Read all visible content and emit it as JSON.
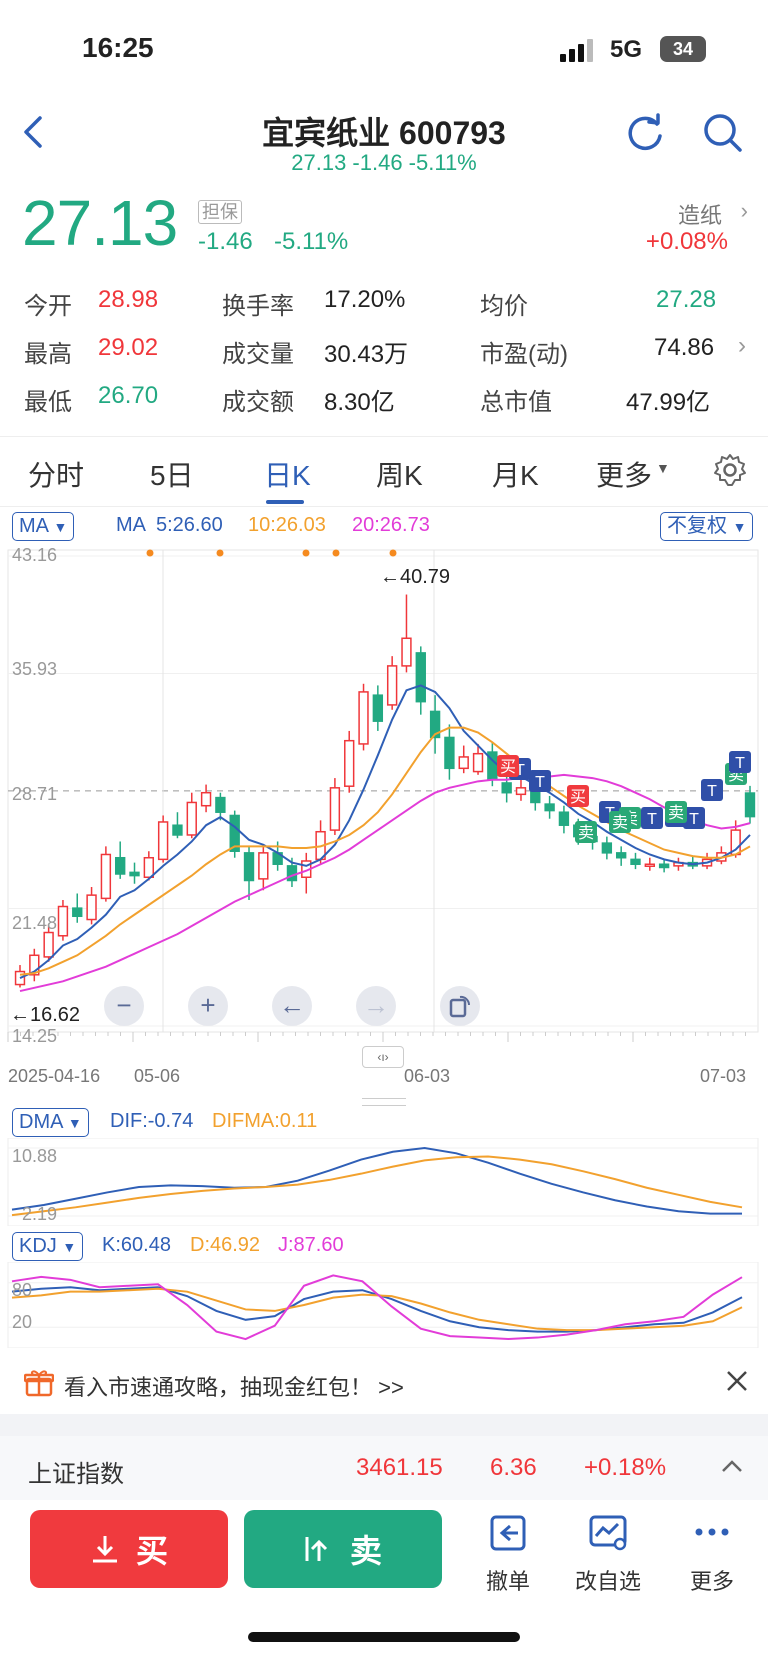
{
  "status": {
    "time": "16:25",
    "network": "5G",
    "battery": "34"
  },
  "header": {
    "stock_name_code": "宜宾纸业 600793",
    "subtitle": "27.13 -1.46 -5.11%"
  },
  "quote": {
    "price": "27.13",
    "badge": "担保",
    "change": "-1.46",
    "change_pct": "-5.11%",
    "sector": "造纸",
    "sector_change": "+0.08%"
  },
  "stats": [
    [
      {
        "label": "今开",
        "value": "28.98",
        "color": "red"
      },
      {
        "label": "换手率",
        "value": "17.20%",
        "color": "dark"
      },
      {
        "label": "均价",
        "value": "27.28",
        "color": "green"
      }
    ],
    [
      {
        "label": "最高",
        "value": "29.02",
        "color": "red"
      },
      {
        "label": "成交量",
        "value": "30.43万",
        "color": "dark"
      },
      {
        "label": "市盈(动)",
        "value": "74.86",
        "color": "dark"
      }
    ],
    [
      {
        "label": "最低",
        "value": "26.70",
        "color": "green"
      },
      {
        "label": "成交额",
        "value": "8.30亿",
        "color": "dark"
      },
      {
        "label": "总市值",
        "value": "47.99亿",
        "color": "dark"
      }
    ]
  ],
  "tabs": [
    "分时",
    "5日",
    "日K",
    "周K",
    "月K",
    "更多"
  ],
  "active_tab": "日K",
  "chart_top": {
    "ma_chip": "MA",
    "ma_label": "MA",
    "ma5": "5:26.60",
    "ma10": "10:26.03",
    "ma20": "20:26.73",
    "adjust_chip": "不复权",
    "y_labels": [
      "43.16",
      "35.93",
      "28.71",
      "21.48",
      "14.25"
    ],
    "high_marker": "←40.79",
    "low_marker": "←16.62",
    "dates": [
      "2025-04-16",
      "05-06",
      "06-03",
      "07-03"
    ]
  },
  "chart_data": [
    {
      "type": "candlestick",
      "title": "",
      "ylim": [
        14.25,
        43.16
      ],
      "y_ticks": [
        43.16,
        35.93,
        28.71,
        21.48,
        14.25
      ],
      "x_ticks": [
        "2025-04-16",
        "05-06",
        "06-03",
        "07-03"
      ],
      "annotations": [
        "←40.79",
        "←16.62"
      ],
      "candles": [
        {
          "o": 16.8,
          "c": 17.6,
          "h": 18.0,
          "l": 16.62
        },
        {
          "o": 17.4,
          "c": 18.6,
          "h": 19.0,
          "l": 17.0
        },
        {
          "o": 18.5,
          "c": 20.0,
          "h": 20.5,
          "l": 18.2
        },
        {
          "o": 19.8,
          "c": 21.6,
          "h": 22.0,
          "l": 19.5
        },
        {
          "o": 21.5,
          "c": 21.0,
          "h": 22.4,
          "l": 20.6
        },
        {
          "o": 20.8,
          "c": 22.3,
          "h": 22.8,
          "l": 20.5
        },
        {
          "o": 22.1,
          "c": 24.8,
          "h": 25.3,
          "l": 21.9
        },
        {
          "o": 24.6,
          "c": 23.6,
          "h": 25.6,
          "l": 23.3
        },
        {
          "o": 23.7,
          "c": 23.5,
          "h": 24.3,
          "l": 23.0
        },
        {
          "o": 23.4,
          "c": 24.6,
          "h": 25.0,
          "l": 23.2
        },
        {
          "o": 24.5,
          "c": 26.8,
          "h": 27.2,
          "l": 24.3
        },
        {
          "o": 26.6,
          "c": 26.0,
          "h": 27.4,
          "l": 25.8
        },
        {
          "o": 26.0,
          "c": 28.0,
          "h": 28.6,
          "l": 25.8
        },
        {
          "o": 27.8,
          "c": 28.6,
          "h": 29.1,
          "l": 27.4
        },
        {
          "o": 28.3,
          "c": 27.4,
          "h": 28.6,
          "l": 26.9
        },
        {
          "o": 27.2,
          "c": 25.0,
          "h": 27.5,
          "l": 24.6
        },
        {
          "o": 24.9,
          "c": 23.2,
          "h": 25.3,
          "l": 22.0
        },
        {
          "o": 23.3,
          "c": 24.9,
          "h": 25.3,
          "l": 22.6
        },
        {
          "o": 24.9,
          "c": 24.2,
          "h": 25.6,
          "l": 23.8
        },
        {
          "o": 24.1,
          "c": 23.2,
          "h": 24.6,
          "l": 22.8
        },
        {
          "o": 23.4,
          "c": 24.4,
          "h": 24.9,
          "l": 22.4
        },
        {
          "o": 24.5,
          "c": 26.2,
          "h": 26.9,
          "l": 24.2
        },
        {
          "o": 26.3,
          "c": 28.9,
          "h": 29.5,
          "l": 26.0
        },
        {
          "o": 29.0,
          "c": 31.8,
          "h": 32.4,
          "l": 28.6
        },
        {
          "o": 31.6,
          "c": 34.8,
          "h": 35.3,
          "l": 31.2
        },
        {
          "o": 34.6,
          "c": 33.0,
          "h": 35.2,
          "l": 32.4
        },
        {
          "o": 34.0,
          "c": 36.4,
          "h": 37.0,
          "l": 33.7
        },
        {
          "o": 36.4,
          "c": 38.1,
          "h": 40.79,
          "l": 36.0
        },
        {
          "o": 37.2,
          "c": 34.2,
          "h": 37.6,
          "l": 33.4
        },
        {
          "o": 33.6,
          "c": 32.0,
          "h": 34.6,
          "l": 31.0
        },
        {
          "o": 32.0,
          "c": 30.1,
          "h": 32.8,
          "l": 29.4
        },
        {
          "o": 30.1,
          "c": 30.8,
          "h": 31.5,
          "l": 29.8
        },
        {
          "o": 29.9,
          "c": 31.0,
          "h": 31.6,
          "l": 29.7
        },
        {
          "o": 31.1,
          "c": 29.4,
          "h": 31.7,
          "l": 29.0
        },
        {
          "o": 29.2,
          "c": 28.6,
          "h": 29.8,
          "l": 28.0
        },
        {
          "o": 28.5,
          "c": 28.9,
          "h": 29.5,
          "l": 28.1
        },
        {
          "o": 28.7,
          "c": 28.0,
          "h": 29.2,
          "l": 27.5
        },
        {
          "o": 27.9,
          "c": 27.5,
          "h": 28.4,
          "l": 27.0
        },
        {
          "o": 27.4,
          "c": 26.6,
          "h": 27.8,
          "l": 26.1
        },
        {
          "o": 26.6,
          "c": 25.9,
          "h": 27.0,
          "l": 25.4
        },
        {
          "o": 25.9,
          "c": 25.6,
          "h": 26.4,
          "l": 25.1
        },
        {
          "o": 25.5,
          "c": 24.9,
          "h": 25.9,
          "l": 24.5
        },
        {
          "o": 24.9,
          "c": 24.6,
          "h": 25.3,
          "l": 24.1
        },
        {
          "o": 24.5,
          "c": 24.2,
          "h": 24.9,
          "l": 23.9
        },
        {
          "o": 24.1,
          "c": 24.2,
          "h": 24.6,
          "l": 23.8
        },
        {
          "o": 24.2,
          "c": 24.0,
          "h": 24.5,
          "l": 23.7
        },
        {
          "o": 24.1,
          "c": 24.3,
          "h": 24.6,
          "l": 23.8
        },
        {
          "o": 24.3,
          "c": 24.1,
          "h": 24.7,
          "l": 23.9
        },
        {
          "o": 24.1,
          "c": 24.5,
          "h": 24.9,
          "l": 23.9
        },
        {
          "o": 24.4,
          "c": 24.9,
          "h": 25.3,
          "l": 24.2
        },
        {
          "o": 24.8,
          "c": 26.3,
          "h": 26.9,
          "l": 24.6
        },
        {
          "o": 28.58,
          "c": 27.13,
          "h": 29.02,
          "l": 26.7
        }
      ],
      "series": [
        {
          "name": "MA5",
          "color": "#2f5fb6",
          "values": [
            17.2,
            17.6,
            18.3,
            19.2,
            19.6,
            20.3,
            21.1,
            22.2,
            22.6,
            23.3,
            24.1,
            24.8,
            25.6,
            26.6,
            27.1,
            26.5,
            25.7,
            25.4,
            24.9,
            24.3,
            24.1,
            24.5,
            25.4,
            26.9,
            28.8,
            30.9,
            33.1,
            34.9,
            35.2,
            34.8,
            33.8,
            32.4,
            31.5,
            30.6,
            29.8,
            29.6,
            29.1,
            28.6,
            28.0,
            27.3,
            26.8,
            26.2,
            25.7,
            25.2,
            24.8,
            24.5,
            24.3,
            24.2,
            24.3,
            24.6,
            25.1,
            26.0
          ]
        },
        {
          "name": "MA10",
          "color": "#f2a12e",
          "values": [
            17.4,
            17.5,
            17.8,
            18.2,
            18.6,
            19.2,
            19.8,
            20.5,
            21.1,
            21.7,
            22.3,
            22.9,
            23.5,
            24.2,
            24.8,
            25.3,
            25.3,
            25.3,
            25.3,
            25.2,
            25.2,
            25.3,
            25.6,
            26.0,
            26.6,
            27.4,
            28.5,
            29.8,
            31.1,
            32.2,
            32.6,
            32.6,
            32.3,
            31.7,
            31.0,
            30.3,
            29.6,
            29.0,
            28.4,
            27.8,
            27.3,
            26.8,
            26.3,
            25.9,
            25.5,
            25.1,
            24.9,
            24.7,
            24.6,
            24.6,
            24.8,
            25.3
          ]
        },
        {
          "name": "MA20",
          "color": "#e23cd8",
          "values": [
            16.4,
            16.6,
            16.8,
            17.0,
            17.3,
            17.6,
            17.9,
            18.3,
            18.7,
            19.1,
            19.5,
            19.9,
            20.4,
            20.9,
            21.4,
            21.9,
            22.3,
            22.7,
            23.1,
            23.5,
            23.8,
            24.2,
            24.6,
            25.1,
            25.7,
            26.3,
            26.9,
            27.5,
            28.1,
            28.6,
            28.9,
            29.1,
            29.3,
            29.4,
            29.4,
            29.5,
            29.6,
            29.6,
            29.7,
            29.6,
            29.5,
            29.3,
            29.0,
            28.6,
            28.2,
            27.7,
            27.3,
            26.9,
            26.6,
            26.4,
            26.5,
            26.73
          ]
        }
      ],
      "signals": [
        "卖",
        "T",
        "T",
        "买",
        "买",
        "T",
        "卖",
        "T",
        "T",
        "T",
        "卖",
        "卖",
        "T",
        "卖",
        "T"
      ]
    },
    {
      "type": "line",
      "title": "DMA",
      "ylim": [
        2.19,
        10.88
      ],
      "y_ticks": [
        10.88,
        2.19
      ],
      "series": [
        {
          "name": "DIF",
          "color": "#2f5fb6",
          "values": [
            3.0,
            3.6,
            4.4,
            5.2,
            5.9,
            6.1,
            6.0,
            5.8,
            5.9,
            6.7,
            8.0,
            9.4,
            10.4,
            10.88,
            10.2,
            9.0,
            7.6,
            6.3,
            5.2,
            4.2,
            3.4,
            2.8,
            2.5,
            2.5
          ]
        },
        {
          "name": "DIFMA",
          "color": "#f2a12e",
          "values": [
            2.3,
            2.8,
            3.3,
            3.9,
            4.5,
            5.0,
            5.4,
            5.7,
            5.9,
            6.2,
            6.8,
            7.6,
            8.5,
            9.3,
            9.7,
            9.8,
            9.4,
            8.8,
            7.9,
            6.9,
            5.8,
            4.9,
            4.0,
            3.3
          ]
        }
      ]
    },
    {
      "type": "line",
      "title": "KDJ",
      "ylim": [
        0,
        100
      ],
      "y_ticks": [
        80,
        20
      ],
      "series": [
        {
          "name": "K",
          "color": "#2f5fb6",
          "values": [
            68,
            72,
            74,
            70,
            72,
            74,
            62,
            42,
            30,
            35,
            58,
            68,
            70,
            58,
            42,
            28,
            20,
            16,
            14,
            14,
            16,
            20,
            24,
            26,
            40,
            60.48
          ]
        },
        {
          "name": "D",
          "color": "#f2a12e",
          "values": [
            60,
            63,
            68,
            68,
            70,
            72,
            68,
            56,
            44,
            42,
            50,
            60,
            64,
            62,
            52,
            40,
            30,
            24,
            18,
            16,
            16,
            18,
            20,
            22,
            28,
            46.92
          ]
        },
        {
          "name": "J",
          "color": "#e23cd8",
          "values": [
            82,
            88,
            84,
            74,
            76,
            78,
            50,
            14,
            4,
            22,
            76,
            90,
            82,
            48,
            18,
            8,
            6,
            4,
            6,
            10,
            16,
            24,
            28,
            34,
            64,
            87.6
          ]
        }
      ]
    }
  ],
  "indicators": {
    "dma_chip": "DMA",
    "dif": "DIF:-0.74",
    "difma": "DIFMA:0.11",
    "dma_y": [
      "10.88",
      "2.19"
    ],
    "kdj_chip": "KDJ",
    "k": "K:60.48",
    "d": "D:46.92",
    "j": "J:87.60",
    "kdj_y": [
      "80",
      "20"
    ]
  },
  "banner": {
    "text": "看入市速通攻略，抽现金红包！ >>"
  },
  "index_bar": {
    "name": "上证指数",
    "value": "3461.15",
    "change": "6.36",
    "change_pct": "+0.18%"
  },
  "actions": {
    "buy": "买",
    "sell": "卖",
    "cancel": "撤单",
    "watchlist": "改自选",
    "more": "更多"
  },
  "colors": {
    "up": "#f0363a",
    "down": "#22a982",
    "brand": "#2f5fb6"
  }
}
